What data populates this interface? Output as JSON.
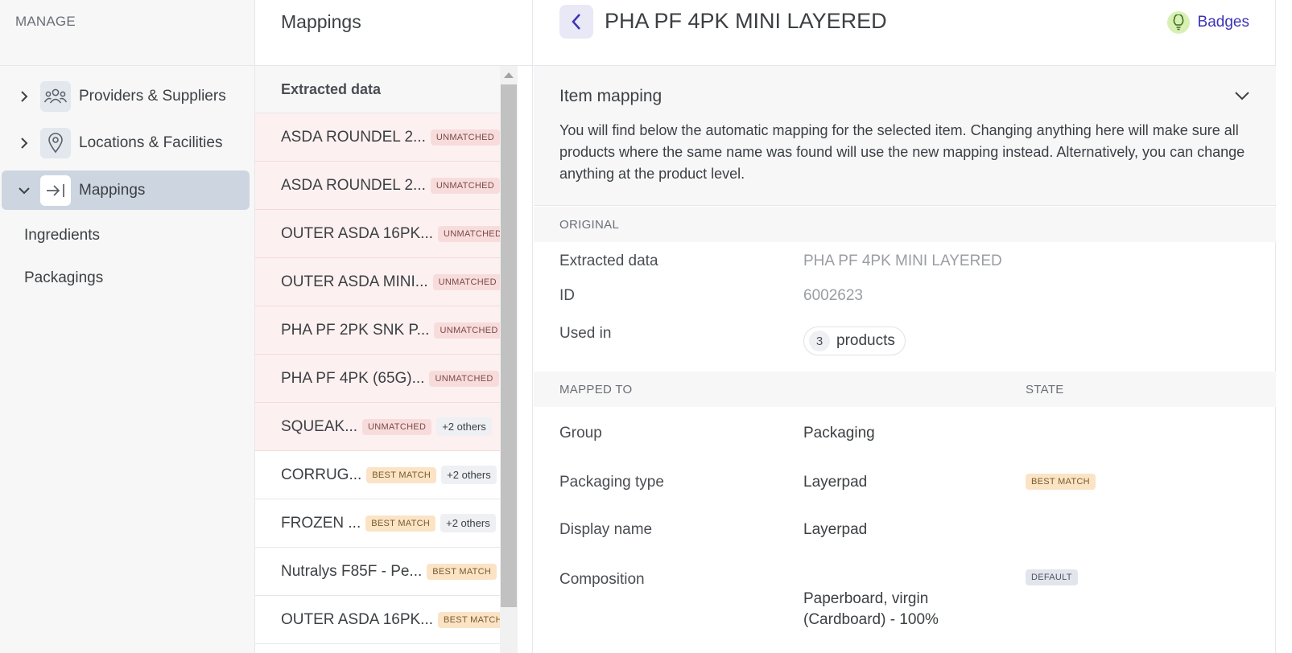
{
  "sidebar": {
    "section_title": "MANAGE",
    "items": [
      {
        "label": "Providers & Suppliers",
        "icon": "users-icon"
      },
      {
        "label": "Locations & Facilities",
        "icon": "location-pin-icon"
      },
      {
        "label": "Mappings",
        "icon": "mapping-arrow-icon"
      }
    ],
    "sub_items": [
      {
        "label": "Ingredients"
      },
      {
        "label": "Packagings"
      }
    ]
  },
  "list": {
    "title": "Mappings",
    "header": "Extracted data",
    "rows": [
      {
        "text": "ASDA ROUNDEL 2...",
        "badge": "UNMATCHED",
        "status": "unmatched",
        "others": ""
      },
      {
        "text": "ASDA ROUNDEL 2...",
        "badge": "UNMATCHED",
        "status": "unmatched",
        "others": ""
      },
      {
        "text": "OUTER ASDA 16PK...",
        "badge": "UNMATCHED",
        "status": "unmatched",
        "others": ""
      },
      {
        "text": "OUTER ASDA MINI...",
        "badge": "UNMATCHED",
        "status": "unmatched",
        "others": ""
      },
      {
        "text": "PHA PF 2PK SNK P...",
        "badge": "UNMATCHED",
        "status": "unmatched",
        "others": ""
      },
      {
        "text": "PHA PF 4PK (65G)...",
        "badge": "UNMATCHED",
        "status": "unmatched",
        "others": ""
      },
      {
        "text": "SQUEAK...",
        "badge": "UNMATCHED",
        "status": "unmatched",
        "others": "+2 others"
      },
      {
        "text": "CORRUG...",
        "badge": "BEST MATCH",
        "status": "best",
        "others": "+2 others"
      },
      {
        "text": "FROZEN ...",
        "badge": "BEST MATCH",
        "status": "best",
        "others": "+2 others"
      },
      {
        "text": "Nutralys F85F - Pe...",
        "badge": "BEST MATCH",
        "status": "best",
        "others": ""
      },
      {
        "text": "OUTER ASDA 16PK...",
        "badge": "BEST MATCH",
        "status": "best",
        "others": ""
      }
    ]
  },
  "detail": {
    "title": "PHA PF 4PK MINI LAYERED",
    "badges_link": "Badges",
    "item_mapping": {
      "title": "Item mapping",
      "description": "You will find below the automatic mapping for the selected item. Changing anything here will make sure all products where the same name was found will use the new mapping instead. Alternatively, you can change anything at the product level."
    },
    "original": {
      "heading": "ORIGINAL",
      "extracted_label": "Extracted data",
      "extracted_value": "PHA PF 4PK MINI LAYERED",
      "id_label": "ID",
      "id_value": "6002623",
      "used_in_label": "Used in",
      "used_in_count": "3",
      "used_in_unit": "products"
    },
    "mapped": {
      "heading": "MAPPED TO",
      "state_heading": "STATE",
      "group_label": "Group",
      "group_value": "Packaging",
      "type_label": "Packaging type",
      "type_value": "Layerpad",
      "type_state": "BEST MATCH",
      "display_label": "Display name",
      "display_value": "Layerpad",
      "composition_label": "Composition",
      "composition_value": "Paperboard, virgin (Cardboard) - 100%",
      "composition_state": "DEFAULT"
    }
  },
  "colors": {
    "accent": "#3d34b5",
    "active_nav": "#cdd6e0",
    "unmatched_bg": "#fdf0f0",
    "best_match_badge": "#fbe4c6"
  }
}
